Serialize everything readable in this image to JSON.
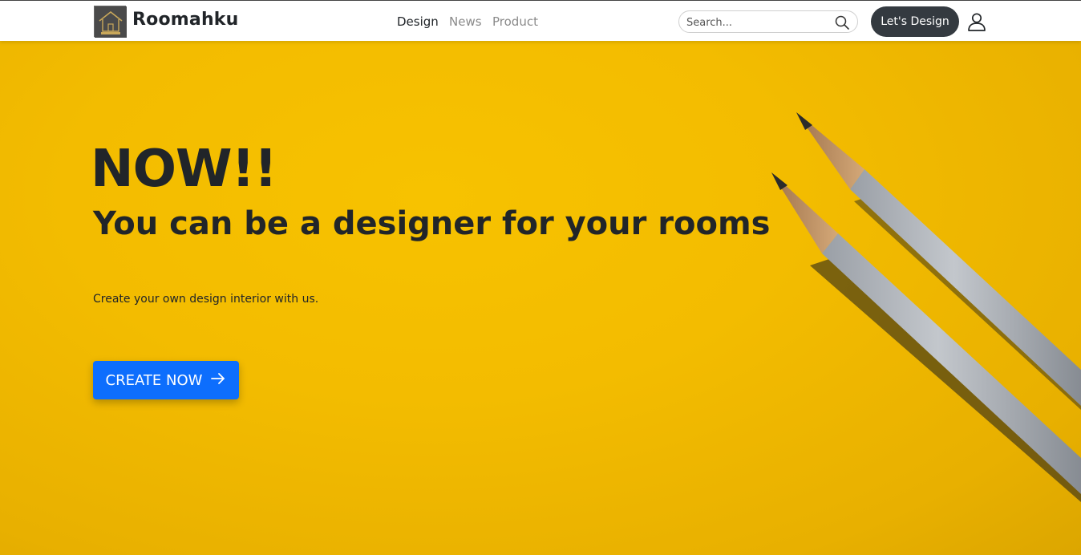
{
  "navbar": {
    "brand": "Roomahku",
    "links": [
      {
        "label": "Design",
        "active": true
      },
      {
        "label": "News",
        "active": false
      },
      {
        "label": "Product",
        "active": false
      }
    ],
    "search": {
      "placeholder": "Search...",
      "value": ""
    },
    "cta_label": "Let's Design",
    "icons": {
      "search": "search-icon",
      "user": "user-icon",
      "logo": "house-logo"
    }
  },
  "hero": {
    "kicker": "NOW!!",
    "title": "You can be a designer for your rooms",
    "subtitle": "Create your own design interior with us.",
    "button_label": "CREATE NOW",
    "button_icon": "arrow-right-icon",
    "background": "yellow-pencils-photo"
  },
  "colors": {
    "hero_background": "#f3bc00",
    "primary_button": "#0d6efd",
    "dark_button": "#343a40",
    "heading_text": "#212529"
  }
}
